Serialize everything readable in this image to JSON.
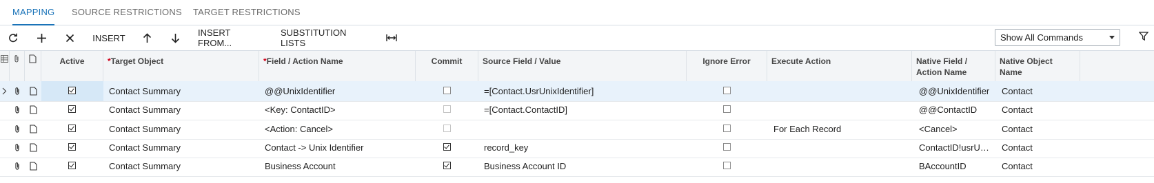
{
  "tabs": [
    {
      "label": "MAPPING",
      "active": true
    },
    {
      "label": "SOURCE RESTRICTIONS",
      "active": false
    },
    {
      "label": "TARGET RESTRICTIONS",
      "active": false
    }
  ],
  "toolbar": {
    "refresh_icon": "refresh-icon",
    "add_icon": "plus-icon",
    "delete_icon": "close-icon",
    "insert_label": "INSERT",
    "up_icon": "arrow-up-icon",
    "down_icon": "arrow-down-icon",
    "insert_from_label": "INSERT FROM...",
    "substitution_label": "SUBSTITUTION LISTS",
    "fit_icon": "fit-columns-icon",
    "commands_select": "Show All Commands",
    "filter_icon": "filter-icon"
  },
  "columns": {
    "active": "Active",
    "target_object": "Target Object",
    "field_action": "Field / Action Name",
    "commit": "Commit",
    "source_field": "Source Field / Value",
    "ignore_error": "Ignore Error",
    "execute_action": "Execute Action",
    "native_field_1": "Native Field /",
    "native_field_2": "Action Name",
    "native_object_1": "Native Object",
    "native_object_2": "Name"
  },
  "rows": [
    {
      "active": true,
      "target": "Contact Summary",
      "field": "@@UnixIdentifier",
      "commit": false,
      "commit_disabled": false,
      "source": "=[Contact.UsrUnixIdentifier]",
      "ignore": false,
      "execute": "",
      "native_field": "@@UnixIdentifier",
      "native_object": "Contact",
      "selected": true
    },
    {
      "active": true,
      "target": "Contact Summary",
      "field": "<Key: ContactID>",
      "commit": false,
      "commit_disabled": true,
      "source": "=[Contact.ContactID]",
      "ignore": false,
      "execute": "",
      "native_field": "@@ContactID",
      "native_object": "Contact",
      "selected": false
    },
    {
      "active": true,
      "target": "Contact Summary",
      "field": "<Action: Cancel>",
      "commit": false,
      "commit_disabled": true,
      "source": "",
      "ignore": false,
      "execute": "For Each Record",
      "native_field": "<Cancel>",
      "native_object": "Contact",
      "selected": false
    },
    {
      "active": true,
      "target": "Contact Summary",
      "field": "Contact -> Unix Identifier",
      "commit": true,
      "commit_disabled": false,
      "source": "record_key",
      "ignore": false,
      "execute": "",
      "native_field": "ContactID!usrUnixIdentifier",
      "native_object": "Contact",
      "selected": false
    },
    {
      "active": true,
      "target": "Contact Summary",
      "field": "Business Account",
      "commit": true,
      "commit_disabled": false,
      "source": "Business Account ID",
      "ignore": false,
      "execute": "",
      "native_field": "BAccountID",
      "native_object": "Contact",
      "selected": false
    }
  ]
}
